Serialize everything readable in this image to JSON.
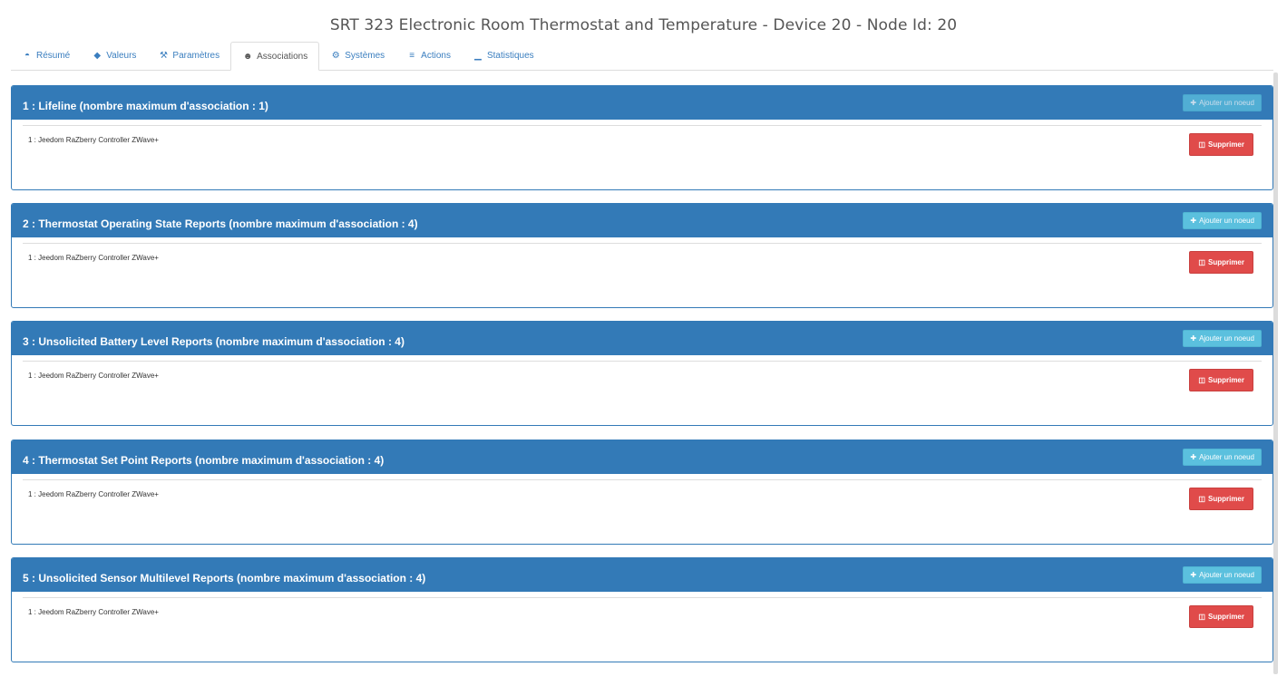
{
  "page": {
    "title": "SRT 323 Electronic Room Thermostat and Temperature - Device 20 - Node Id: 20"
  },
  "tabs": [
    {
      "label": "Résumé",
      "icon": "dashboard-icon",
      "glyph": "◓"
    },
    {
      "label": "Valeurs",
      "icon": "tag-icon",
      "glyph": "◆"
    },
    {
      "label": "Paramètres",
      "icon": "wrench-icon",
      "glyph": "⚒"
    },
    {
      "label": "Associations",
      "icon": "users-icon",
      "glyph": "☻",
      "active": true
    },
    {
      "label": "Systèmes",
      "icon": "cogs-icon",
      "glyph": "⚙"
    },
    {
      "label": "Actions",
      "icon": "sliders-icon",
      "glyph": "≡"
    },
    {
      "label": "Statistiques",
      "icon": "chart-icon",
      "glyph": "▁"
    }
  ],
  "groups": [
    {
      "title": "1 : Lifeline (nombre maximum d'association : 1)",
      "add_label": "Ajouter un noeud",
      "add_disabled": true,
      "nodes": [
        {
          "label": "1 : Jeedom RaZberry Controller ZWave+",
          "delete_label": "Supprimer"
        }
      ]
    },
    {
      "title": "2 : Thermostat Operating State Reports (nombre maximum d'association : 4)",
      "add_label": "Ajouter un noeud",
      "add_disabled": false,
      "nodes": [
        {
          "label": "1 : Jeedom RaZberry Controller ZWave+",
          "delete_label": "Supprimer"
        }
      ]
    },
    {
      "title": "3 : Unsolicited Battery Level Reports (nombre maximum d'association : 4)",
      "add_label": "Ajouter un noeud",
      "add_disabled": false,
      "nodes": [
        {
          "label": "1 : Jeedom RaZberry Controller ZWave+",
          "delete_label": "Supprimer"
        }
      ]
    },
    {
      "title": "4 : Thermostat Set Point Reports (nombre maximum d'association : 4)",
      "add_label": "Ajouter un noeud",
      "add_disabled": false,
      "nodes": [
        {
          "label": "1 : Jeedom RaZberry Controller ZWave+",
          "delete_label": "Supprimer"
        }
      ]
    },
    {
      "title": "5 : Unsolicited Sensor Multilevel Reports (nombre maximum d'association : 4)",
      "add_label": "Ajouter un noeud",
      "add_disabled": false,
      "nodes": [
        {
          "label": "1 : Jeedom RaZberry Controller ZWave+",
          "delete_label": "Supprimer"
        }
      ]
    }
  ],
  "icons": {
    "add": "plus-icon",
    "delete": "trash-icon"
  },
  "colors": {
    "panel_header": "#337ab7",
    "add_button": "#5bc0de",
    "delete_button": "#e04b4a",
    "tab_link": "#3a7ebf"
  }
}
